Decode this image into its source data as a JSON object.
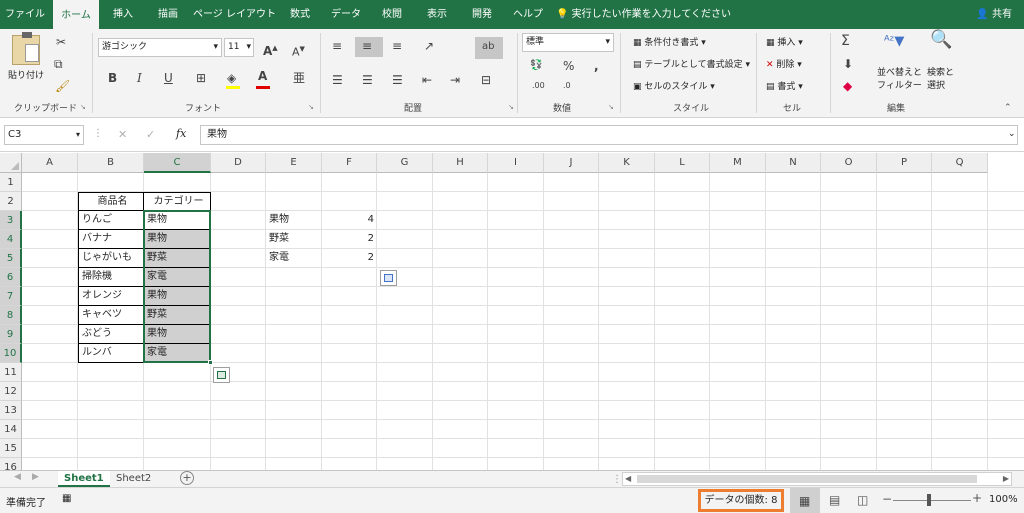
{
  "tabs": [
    "ファイル",
    "ホーム",
    "挿入",
    "描画",
    "ページ レイアウト",
    "数式",
    "データ",
    "校閲",
    "表示",
    "開発",
    "ヘルプ"
  ],
  "tell_me": "実行したい作業を入力してください",
  "share": "共有",
  "ribbon": {
    "clipboard": {
      "paste": "貼り付け",
      "label": "クリップボード"
    },
    "font": {
      "name": "游ゴシック",
      "size": "11",
      "label": "フォント",
      "font_color": "#e00000"
    },
    "alignment": {
      "label": "配置"
    },
    "number": {
      "format": "標準",
      "label": "数値"
    },
    "styles": {
      "conditional": "条件付き書式",
      "table": "テーブルとして書式設定",
      "cell_styles": "セルのスタイル",
      "label": "スタイル"
    },
    "cells": {
      "insert": "挿入",
      "delete": "削除",
      "format": "書式",
      "label": "セル"
    },
    "editing": {
      "sort": "並べ替えと",
      "filter": "フィルター",
      "find": "検索と",
      "select": "選択",
      "label": "編集"
    }
  },
  "formula_bar": {
    "name_box": "C3",
    "fx": "fx",
    "content": "果物"
  },
  "columns": [
    "A",
    "B",
    "C",
    "D",
    "E",
    "F",
    "G",
    "H",
    "I",
    "J",
    "K",
    "L",
    "M",
    "N",
    "O",
    "P",
    "Q"
  ],
  "rows": [
    "1",
    "2",
    "3",
    "4",
    "5",
    "6",
    "7",
    "8",
    "9",
    "10",
    "11",
    "12",
    "13",
    "14",
    "15",
    "16"
  ],
  "table": {
    "headers": [
      "商品名",
      "カテゴリー"
    ],
    "rows": [
      [
        "りんご",
        "果物"
      ],
      [
        "バナナ",
        "果物"
      ],
      [
        "じゃがいも",
        "野菜"
      ],
      [
        "掃除機",
        "家電"
      ],
      [
        "オレンジ",
        "果物"
      ],
      [
        "キャベツ",
        "野菜"
      ],
      [
        "ぶどう",
        "果物"
      ],
      [
        "ルンバ",
        "家電"
      ]
    ]
  },
  "summary": [
    [
      "果物",
      "4"
    ],
    [
      "野菜",
      "2"
    ],
    [
      "家電",
      "2"
    ]
  ],
  "sheets": [
    "Sheet1",
    "Sheet2"
  ],
  "status": {
    "ready": "準備完了",
    "count": "データの個数: 8",
    "zoom": "100%"
  },
  "colors": {
    "brand": "#217346",
    "highlight": "#ed7d31",
    "selected_fill": "#d0d0d0"
  }
}
